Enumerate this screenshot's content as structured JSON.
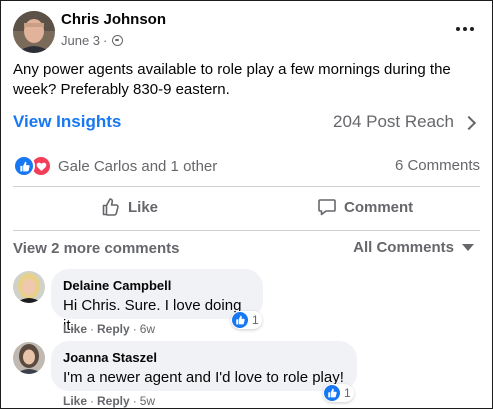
{
  "post": {
    "author": "Chris Johnson",
    "date": "June 3",
    "separator": "·",
    "text": "Any power agents available to role play a few mornings during the week? Preferably 830-9 eastern.",
    "insights_label": "View Insights",
    "reach_label": "204 Post Reach",
    "reactions_text": "Gale Carlos and 1 other",
    "comments_count": "6 Comments"
  },
  "actions": {
    "like": "Like",
    "comment": "Comment"
  },
  "comments_section": {
    "view_more": "View 2 more comments",
    "filter": "All Comments"
  },
  "comments": [
    {
      "name": "Delaine Campbell",
      "text": "Hi Chris. Sure. I love doing it.",
      "reaction_count": "1",
      "like": "Like",
      "reply": "Reply",
      "sep": "·",
      "age": "6w"
    },
    {
      "name": "Joanna Staszel",
      "text": "I'm a newer agent and I'd love to role play!",
      "reaction_count": "1",
      "like": "Like",
      "reply": "Reply",
      "sep": "·",
      "age": "5w"
    }
  ],
  "colors": {
    "accent": "#1877f2",
    "love": "#f33e58",
    "muted_text": "#65676b",
    "bubble": "#f0f2f5"
  },
  "icons": [
    "globe-icon",
    "more-options-icon",
    "chevron-right-icon",
    "like-reaction-icon",
    "love-reaction-icon",
    "thumbs-up-icon",
    "comment-icon",
    "caret-down-icon"
  ]
}
